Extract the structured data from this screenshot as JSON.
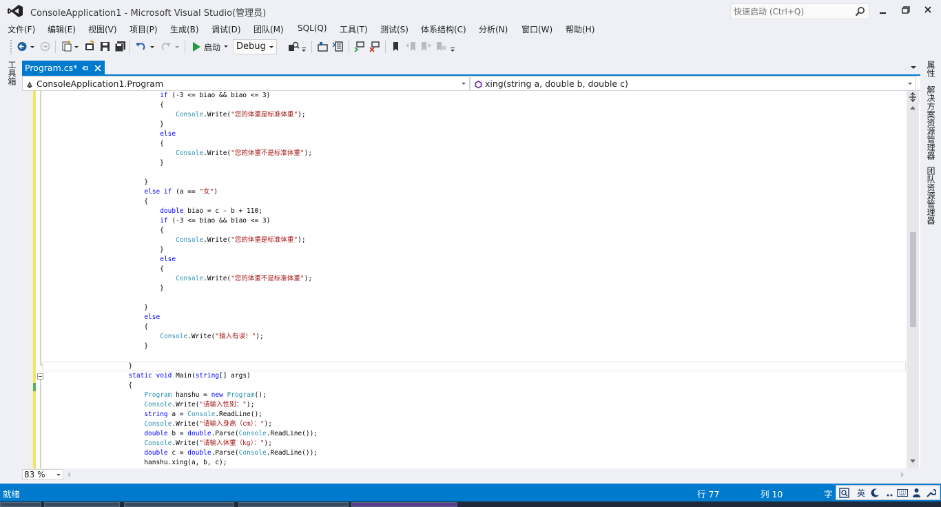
{
  "window": {
    "title": "ConsoleApplication1 - Microsoft Visual Studio(管理员)",
    "quick_launch_placeholder": "快速启动 (Ctrl+Q)"
  },
  "menu": [
    "文件(F)",
    "编辑(E)",
    "视图(V)",
    "项目(P)",
    "生成(B)",
    "调试(D)",
    "团队(M)",
    "SQL(Q)",
    "工具(T)",
    "测试(S)",
    "体系结构(C)",
    "分析(N)",
    "窗口(W)",
    "帮助(H)"
  ],
  "toolbar": {
    "start_label": "启动",
    "config_value": "Debug"
  },
  "left_tabs": {
    "toolbox": "工具箱"
  },
  "right_tabs": {
    "properties": "属性",
    "solution_explorer": "解决方案资源管理器",
    "team_explorer": "团队资源管理器"
  },
  "doc_tab": {
    "label": "Program.cs*"
  },
  "nav": {
    "type_value": "ConsoleApplication1.Program",
    "member_value": "xing(string a, double b, double c)"
  },
  "zoom": {
    "value": "83 %"
  },
  "status": {
    "ready": "就绪",
    "line": "行 77",
    "col": "列 10",
    "char": "字"
  },
  "ime": {
    "lang": "英"
  },
  "colors": {
    "accent": "#007acc",
    "keyword": "#0000ff",
    "type": "#2b91af",
    "string": "#a31515"
  }
}
